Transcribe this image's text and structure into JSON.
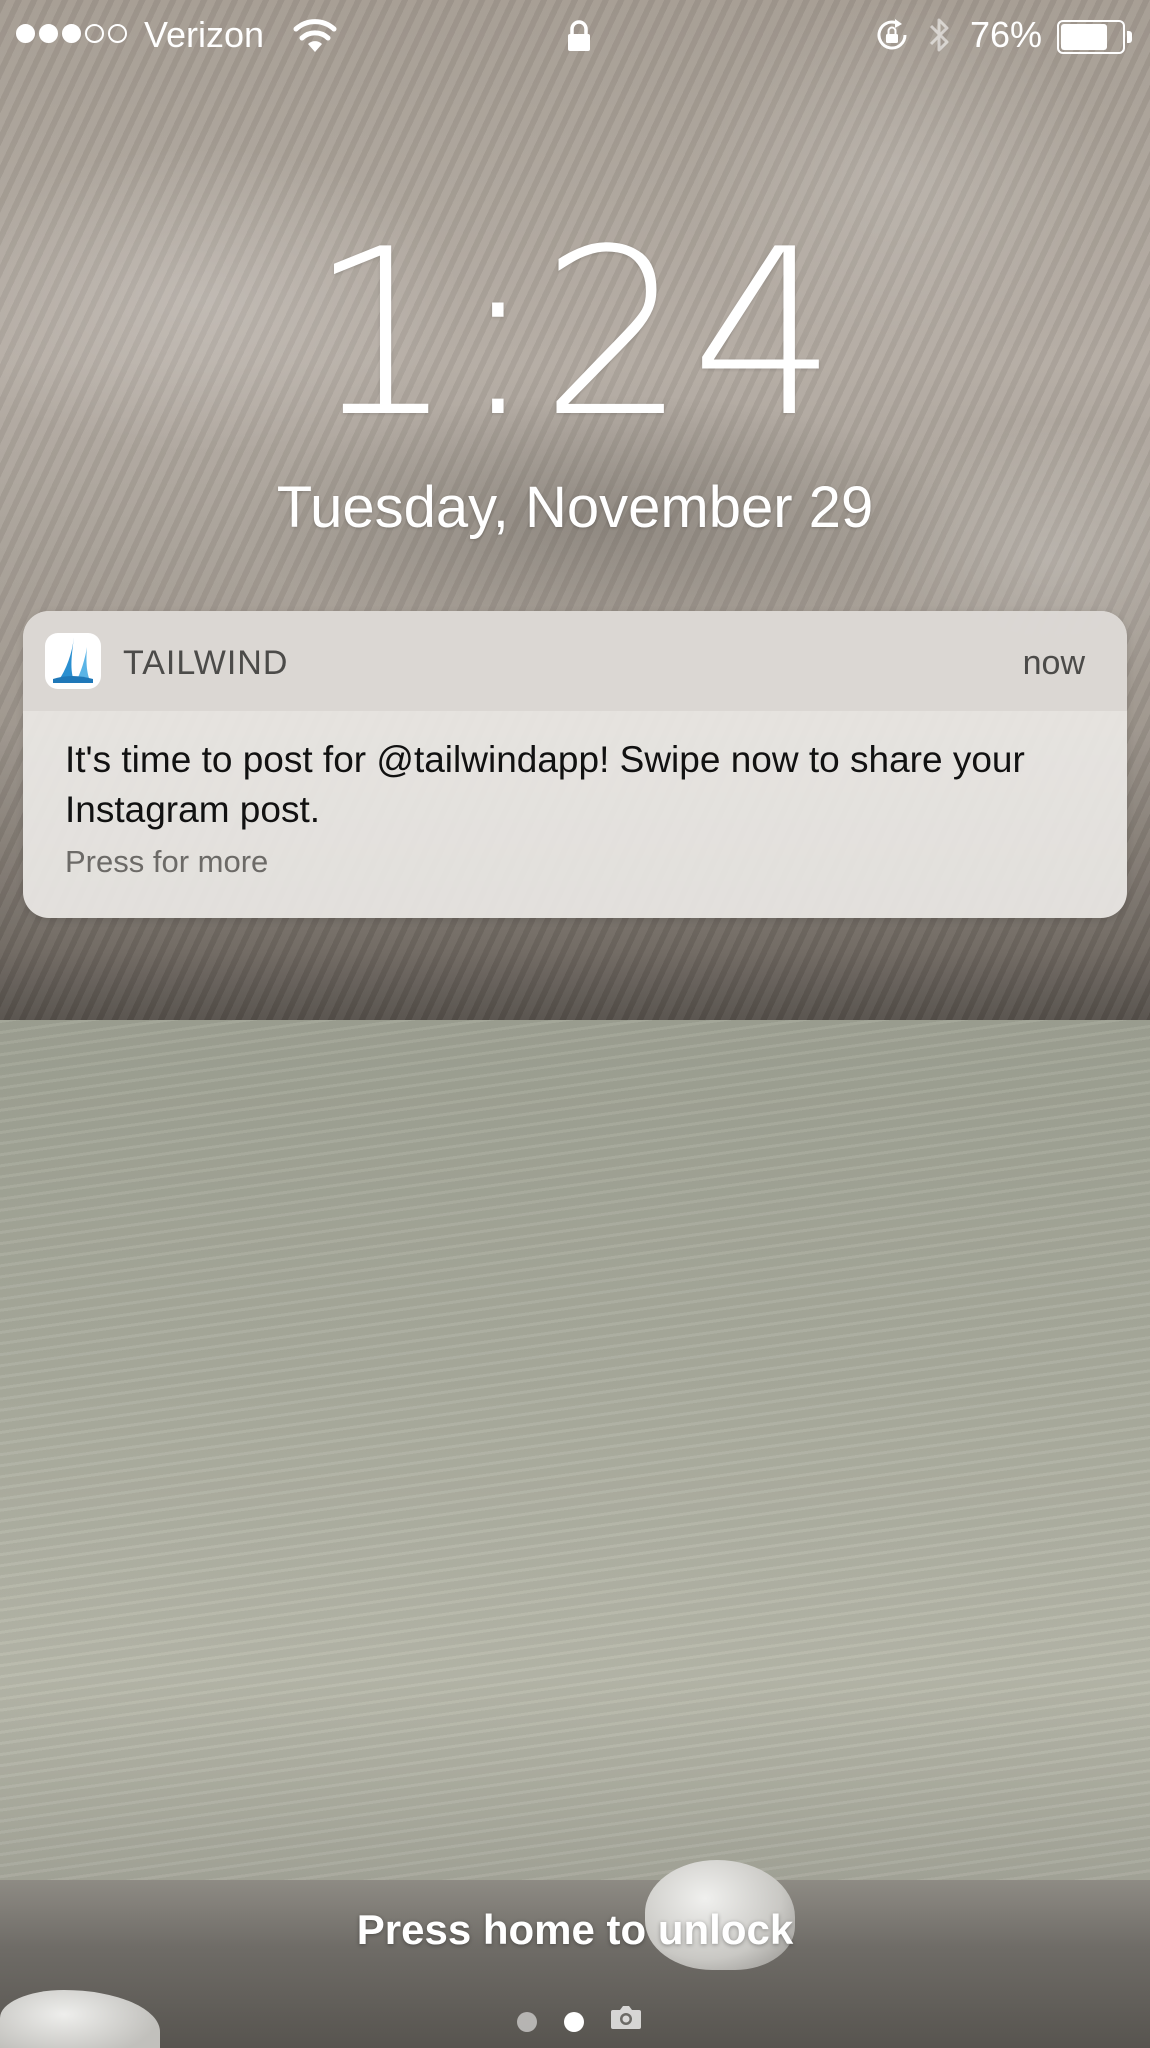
{
  "status_bar": {
    "signal_strength": 3,
    "signal_max": 5,
    "carrier": "Verizon",
    "wifi_icon": "wifi-icon",
    "lock_icon": "lock-icon",
    "rotation_lock_icon": "rotation-lock-icon",
    "bluetooth_icon": "bluetooth-icon",
    "battery_percent": "76%",
    "battery_level": 0.76
  },
  "lock_screen": {
    "time": "1:24",
    "date": "Tuesday, November 29",
    "unlock_hint": "Press home to unlock"
  },
  "notification": {
    "app_icon": "tailwind-app-icon",
    "app_name": "TAILWIND",
    "time": "now",
    "message": "It's time to post for @tailwindapp! Swipe now to share your Instagram post.",
    "more": "Press for more"
  },
  "page_indicator": {
    "pages": 2,
    "current": 2,
    "camera_icon": "camera-icon"
  },
  "colors": {
    "accent_tailwind": "#2a8fd0"
  }
}
